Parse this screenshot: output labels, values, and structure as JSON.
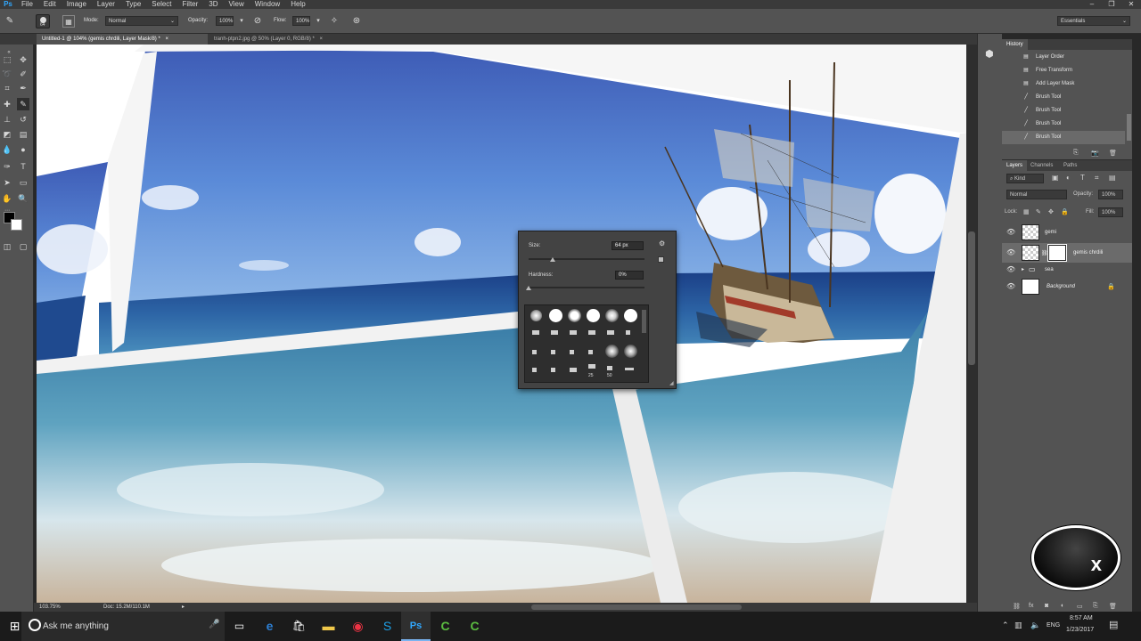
{
  "menu": {
    "logo": "Ps",
    "items": [
      "File",
      "Edit",
      "Image",
      "Layer",
      "Type",
      "Select",
      "Filter",
      "3D",
      "View",
      "Window",
      "Help"
    ]
  },
  "window_controls": [
    "–",
    "❐",
    "✕"
  ],
  "options": {
    "brush_size": "64",
    "mode_label": "Mode:",
    "mode_value": "Normal",
    "opacity_label": "Opacity:",
    "opacity_value": "100%",
    "flow_label": "Flow:",
    "flow_value": "100%",
    "workspace": "Essentials"
  },
  "tabs": [
    {
      "label": "Untitled-1 @ 104% (gemis chrdili, Layer Mask/8) *",
      "close": "×"
    },
    {
      "label": "tranh-ptpn2.jpg @ 50% (Layer 0, RGB/8) *",
      "close": "×"
    }
  ],
  "status": {
    "zoom": "103.75%",
    "doc": "Doc: 15.2M/110.1M"
  },
  "brush_picker": {
    "size_label": "Size:",
    "size_value": "64 px",
    "size_fraction": 0.21,
    "hardness_label": "Hardness:",
    "hardness_value": "0%",
    "hardness_fraction": 0.0,
    "preset_label_25": "25",
    "preset_label_50": "50"
  },
  "history": {
    "tab": "History",
    "items": [
      {
        "icon": "doc-icon",
        "label": "Layer Order"
      },
      {
        "icon": "doc-icon",
        "label": "Free Transform"
      },
      {
        "icon": "doc-icon",
        "label": "Add Layer Mask"
      },
      {
        "icon": "brush-icon",
        "label": "Brush Tool"
      },
      {
        "icon": "brush-icon",
        "label": "Brush Tool"
      },
      {
        "icon": "brush-icon",
        "label": "Brush Tool"
      },
      {
        "icon": "brush-icon",
        "label": "Brush Tool"
      }
    ]
  },
  "layers_panel": {
    "tabs": [
      "Layers",
      "Channels",
      "Paths"
    ],
    "kind": "Kind",
    "blend": "Normal",
    "opacity_label": "Opacity:",
    "opacity_value": "100%",
    "lock_label": "Lock:",
    "fill_label": "Fill:",
    "fill_value": "100%",
    "layers": [
      {
        "name": "gemi",
        "type": "transparent"
      },
      {
        "name": "gemis chrdili",
        "type": "masked",
        "selected": true
      },
      {
        "name": "sea",
        "type": "group"
      },
      {
        "name": "Background",
        "type": "background"
      }
    ]
  },
  "taskbar": {
    "search_placeholder": "Ask me anything",
    "lang": "ENG",
    "time": "8:57 AM",
    "date": "1/23/2017"
  },
  "overlay_close": "x"
}
